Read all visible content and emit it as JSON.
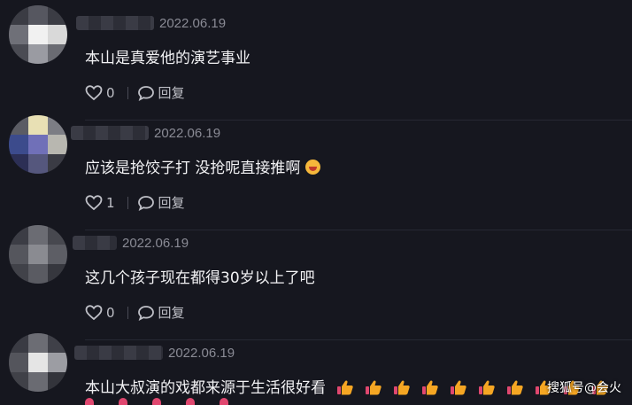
{
  "comments": [
    {
      "date": "2022.06.19",
      "text": "本山是真爱他的演艺事业",
      "likes": "0",
      "reply_label": "回复"
    },
    {
      "date": "2022.06.19",
      "text": "应该是抢饺子打 没抢呢直接推啊",
      "likes": "1",
      "reply_label": "回复"
    },
    {
      "date": "2022.06.19",
      "text": "这几个孩子现在都得30岁以上了吧",
      "likes": "0",
      "reply_label": "回复"
    },
    {
      "date": "2022.06.19",
      "text": "本山大叔演的戏都来源于生活很好看",
      "likes": "",
      "reply_label": ""
    }
  ],
  "watermark": "搜狐号@会火",
  "colors": {
    "background": "#16171f",
    "text": "#f2f2f4",
    "meta": "#8a8b95",
    "thumb": "#f5a623"
  },
  "icons": {
    "like": "heart-outline-icon",
    "reply": "speech-bubble-icon",
    "emoji": "grinning-face-emoji",
    "thumb": "thumbs-up-emoji"
  }
}
